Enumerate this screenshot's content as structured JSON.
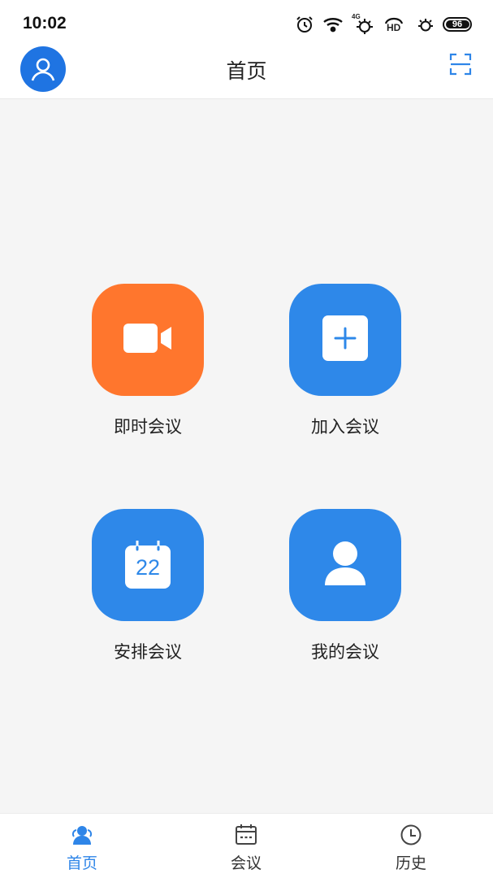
{
  "status_bar": {
    "time": "10:02",
    "battery": "96",
    "network_label": "4G",
    "hd_label": "HD",
    "icons": [
      "alarm-icon",
      "wifi-icon",
      "signal-icon",
      "hd-call-icon",
      "signal-icon",
      "battery-icon"
    ]
  },
  "header": {
    "title": "首页",
    "avatar_icon": "user-avatar-icon",
    "scan_icon": "scan-icon"
  },
  "actions": [
    {
      "label": "即时会议",
      "icon": "video-camera-icon",
      "color": "#FF762D"
    },
    {
      "label": "加入会议",
      "icon": "plus-square-icon",
      "color": "#2E88E9"
    },
    {
      "label": "安排会议",
      "icon": "calendar-icon",
      "color": "#2E88E9",
      "icon_text": "22"
    },
    {
      "label": "我的会议",
      "icon": "person-icon",
      "color": "#2E88E9"
    }
  ],
  "tabs": [
    {
      "label": "首页",
      "icon": "home-people-icon",
      "active": true
    },
    {
      "label": "会议",
      "icon": "calendar-icon",
      "active": false
    },
    {
      "label": "历史",
      "icon": "clock-icon",
      "active": false
    }
  ],
  "colors": {
    "accent": "#2E85E8",
    "orange": "#FF762D",
    "background": "#F5F5F5"
  }
}
